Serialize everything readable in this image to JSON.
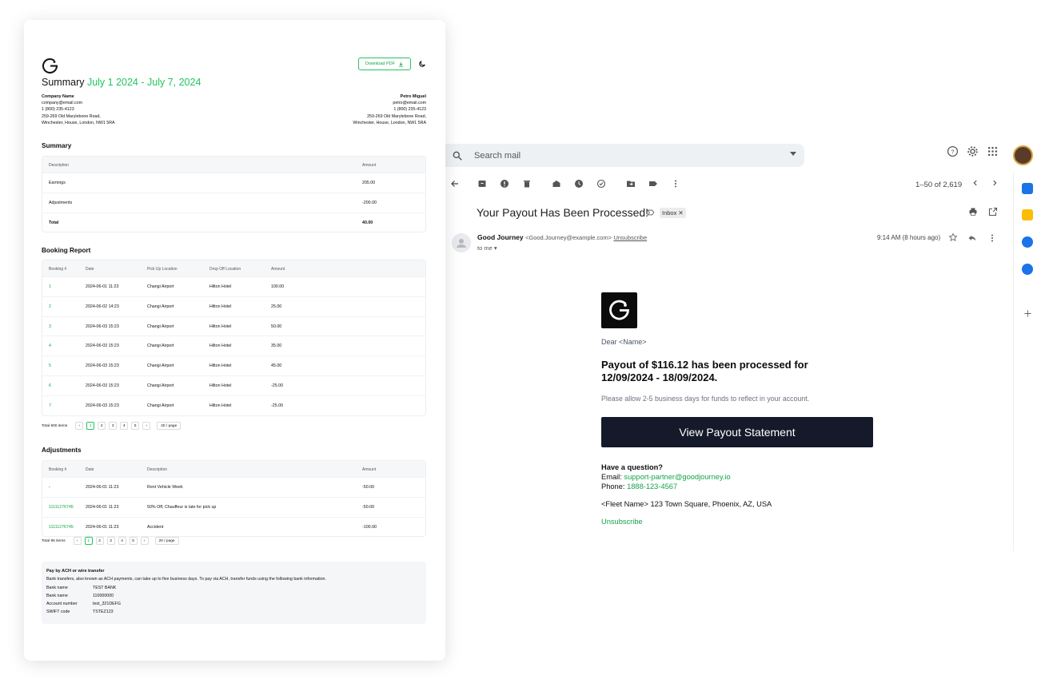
{
  "gmail": {
    "search_placeholder": "Search mail",
    "pager": "1–50 of 2,619",
    "subject": "Your Payout Has Been Processed!",
    "label_badge": "Inbox ✕",
    "sender_name": "Good Journey",
    "sender_email": "<Good.Journey@example.com>",
    "unsubscribe_link": "Unsubscribe",
    "to_me": "to me ▾",
    "time": "9:14 AM (8 hours ago)"
  },
  "email": {
    "dear": "Dear <Name>",
    "headline": "Payout of $116.12 has been processed for 12/09/2024 - 18/09/2024.",
    "allow": "Please allow 2-5 business days for funds to reflect in your account.",
    "cta": "View Payout Statement",
    "question": "Have a question?",
    "email_label": "Email: ",
    "email_value": "support-partner@goodjourney.io",
    "phone_label": "Phone: ",
    "phone_value": "1888-123-4567",
    "address": "<Fleet Name> 123 Town Square, Phoenix, AZ, USA",
    "unsubscribe": "Unsubscribe"
  },
  "statement": {
    "download": "Download PDF",
    "title_prefix": "Summary ",
    "title_dates": "July 1 2024 - July 7, 2024",
    "company": {
      "name": "Company Name",
      "email": "company@email.com",
      "phone": "1 (800) 235-4123",
      "addr1": "259-269 Old Marylebone Road,",
      "addr2": "Winchester, House, London, NW1 5RA"
    },
    "person": {
      "name": "Petro Miguel",
      "email": "petro@email.com",
      "phone": "1 (800) 235-4123",
      "addr1": "259-269 Old Marylebone Road,",
      "addr2": "Winchester, House, London, NW1 5RA"
    },
    "summary_title": "Summary",
    "summary_headers": [
      "Description",
      "Amount"
    ],
    "summary_rows": [
      [
        "Earnings",
        "205.00"
      ],
      [
        "Adjustments",
        "-200.00"
      ],
      [
        "Total",
        "40.00"
      ]
    ],
    "booking_title": "Booking Report",
    "booking_headers": [
      "Booking #",
      "Date",
      "Pick Up Location",
      "Drop Off Location",
      "Amount"
    ],
    "booking_rows": [
      [
        "1",
        "2024-06-01 11:23",
        "Changi Airport",
        "Hilton Hotel",
        "100.00"
      ],
      [
        "2",
        "2024-06-02 14:23",
        "Changi Airport",
        "Hilton Hotel",
        "25.00"
      ],
      [
        "3",
        "2024-06-03 15:23",
        "Changi Airport",
        "Hilton Hotel",
        "50.00"
      ],
      [
        "4",
        "2024-06-03 15:23",
        "Changi Airport",
        "Hilton Hotel",
        "35.00"
      ],
      [
        "5",
        "2024-06-03 15:23",
        "Changi Airport",
        "Hilton Hotel",
        "45.00"
      ],
      [
        "6",
        "2024-06-03 15:23",
        "Changi Airport",
        "Hilton Hotel",
        "-25.00"
      ],
      [
        "7",
        "2024-06-03 15:23",
        "Changi Airport",
        "Hilton Hotel",
        "-25.00"
      ]
    ],
    "booking_total": "Total 600 items",
    "pages": [
      "1",
      "2",
      "3",
      "4",
      "5"
    ],
    "per_page": "20 / page",
    "adj_title": "Adjustments",
    "adj_headers": [
      "Booking #",
      "Date",
      "Description",
      "Amount"
    ],
    "adj_rows": [
      [
        "-",
        "2024-06-01 11:23",
        "Rent Vehicle Week",
        "-50.00"
      ],
      [
        "11111276745",
        "2024-06-01 11:23",
        "50% Off, Chauffeur is late for pick up",
        "-50.00"
      ],
      [
        "11111276745",
        "2024-06-01 11:23",
        "Accident",
        "-100.00"
      ]
    ],
    "adj_total": "Total 85 items",
    "bank": {
      "title": "Pay by ACH or wire transfer",
      "desc": "Bank transfers, also known as ACH payments, can take up to five business days. To pay via ACH, transfer funds using the following bank information.",
      "rows": [
        [
          "Bank name",
          "TEST BANK"
        ],
        [
          "Bank name",
          "110000000"
        ],
        [
          "Account number",
          "test_321DEFG"
        ],
        [
          "SWIFT code",
          "TSTEZ123"
        ]
      ]
    }
  }
}
